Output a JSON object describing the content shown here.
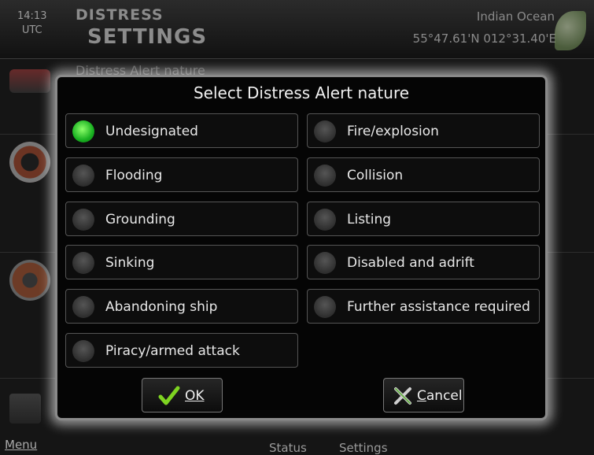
{
  "header": {
    "time": "14:13",
    "timezone": "UTC",
    "title_line1": "DISTRESS",
    "title_line2": "SETTINGS",
    "region": "Indian Ocean",
    "position": "55°47.61'N  012°31.40'E"
  },
  "background": {
    "behind_text": "Distress Alert nature",
    "menu_label": "Menu",
    "bottom_tabs": [
      "Status",
      "Settings"
    ]
  },
  "dialog": {
    "title": "Select Distress Alert nature",
    "selected": "Undesignated",
    "options_left": [
      "Undesignated",
      "Flooding",
      "Grounding",
      "Sinking",
      "Abandoning ship",
      "Piracy/armed attack"
    ],
    "options_right": [
      "Fire/explosion",
      "Collision",
      "Listing",
      "Disabled and adrift",
      "Further assistance required"
    ],
    "ok_label": "OK",
    "cancel_label": "Cancel"
  },
  "colors": {
    "selected_radio": "#18b020",
    "unselected_radio": "#3a3a3a",
    "ok_check": "#7ed321",
    "dialog_glow": "#ffffff"
  }
}
